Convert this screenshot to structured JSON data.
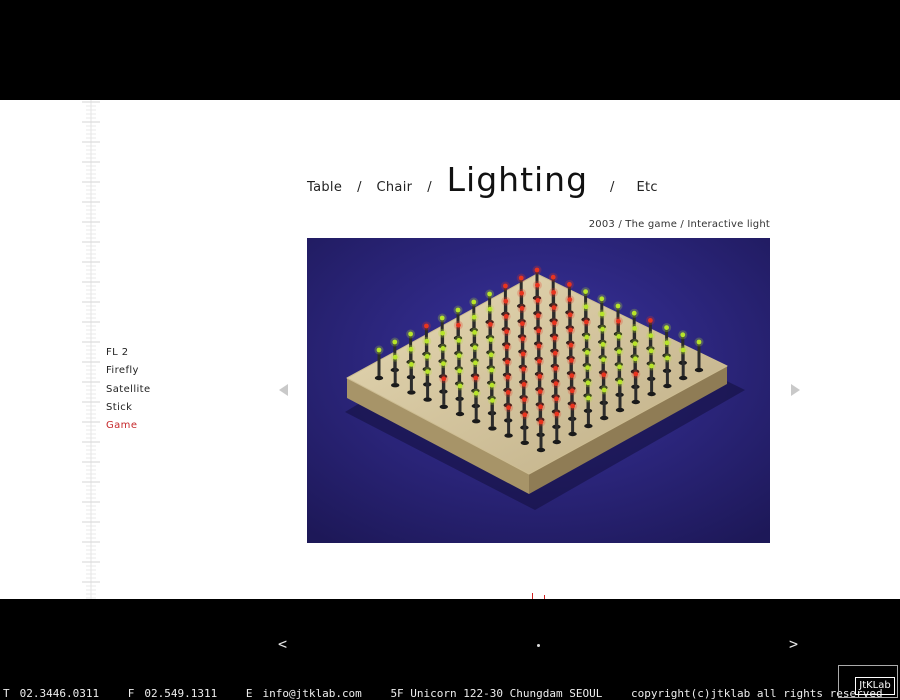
{
  "nav": {
    "categories": [
      "Table",
      "Chair",
      "Lighting",
      "Etc"
    ],
    "separator": "/",
    "active_category": "Lighting"
  },
  "caption": "2003 / The game / Interactive light",
  "submenu": {
    "items": [
      "FL 2",
      "Firefly",
      "Satellite",
      "Stick",
      "Game"
    ],
    "active": "Game"
  },
  "photo": {
    "background_color": "#2a2277",
    "board_color": "#d8c9a2",
    "led_colors": [
      "#e8341f",
      "#b7e52a"
    ]
  },
  "bottom_nav": {
    "prev_label": "<",
    "next_label": ">"
  },
  "footer": {
    "phone_key": "T",
    "phone": "02.3446.0311",
    "fax_key": "F",
    "fax": "02.549.1311",
    "email_key": "E",
    "email": "info@jtklab.com",
    "address": "5F Unicorn 122-30 Chungdam SEOUL",
    "copyright": "copyright(c)jtklab all rights reserved"
  },
  "logo": {
    "text": "JtKLab"
  }
}
